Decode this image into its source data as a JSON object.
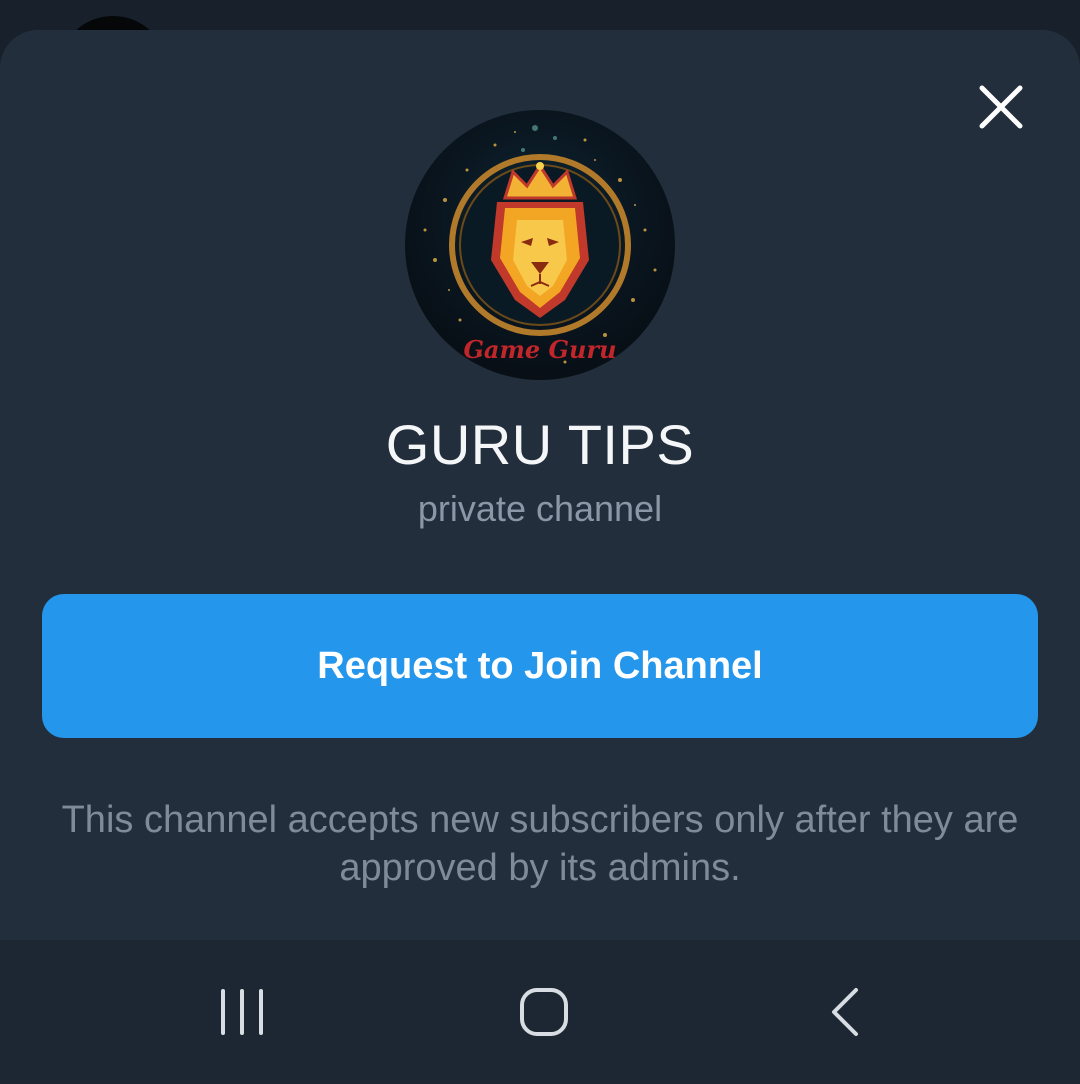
{
  "dialog": {
    "title": "GURU TIPS",
    "subtitle": "private channel",
    "join_button_label": "Request to Join Channel",
    "info_text": "This channel accepts new subscribers only after they are approved by its admins.",
    "close_icon": "close-icon",
    "avatar_logo_text": "Game Guru"
  },
  "navbar": {
    "recents_icon": "recents-icon",
    "home_icon": "home-icon",
    "back_icon": "back-icon"
  },
  "colors": {
    "sheet_background": "#222e3c",
    "accent": "#2497ec",
    "title": "#f4f6f8",
    "secondary_text": "#8a97a6"
  }
}
